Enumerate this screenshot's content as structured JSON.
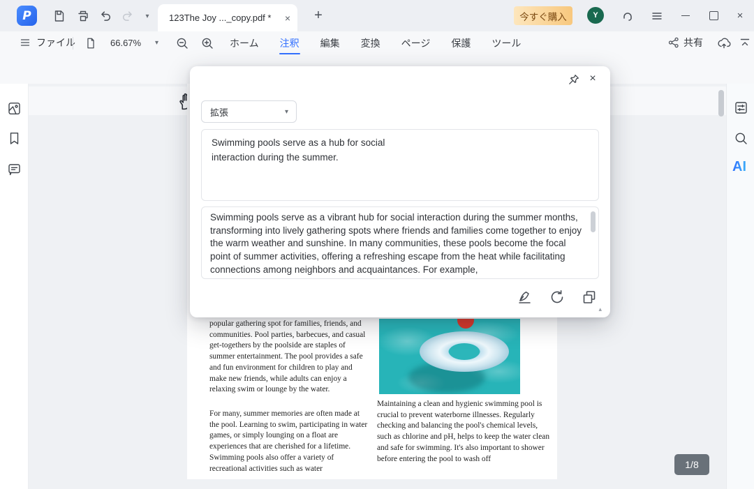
{
  "titlebar": {
    "tab_title": "123The Joy ..._copy.pdf *",
    "buy_label": "今すぐ購入",
    "avatar_initial": "Y"
  },
  "menubar": {
    "file_label": "ファイル",
    "zoom_level": "66.67%",
    "tabs": [
      {
        "label": "ホーム"
      },
      {
        "label": "注釈"
      },
      {
        "label": "編集"
      },
      {
        "label": "変換"
      },
      {
        "label": "ページ"
      },
      {
        "label": "保護"
      },
      {
        "label": "ツール"
      }
    ],
    "share_label": "共有"
  },
  "ai_panel": {
    "mode_selected": "拡張",
    "input_text": "Swimming pools serve as a hub for social\ninteraction during the summer.",
    "output_text": "Swimming pools serve as a vibrant hub for social interaction during the summer months, transforming into lively gathering spots where friends and families come together to enjoy the warm weather and sunshine. In many communities, these pools become the focal point of summer activities, offering a refreshing escape from the heat while facilitating connections among neighbors and acquaintances. For example,"
  },
  "document": {
    "left_paragraph_1": "popular gathering spot for families, friends, and communities. Pool parties, barbecues, and casual get-togethers by the poolside are staples of summer entertainment. The pool provides a safe and fun environment for children to play and make new friends, while adults can enjoy a relaxing swim or lounge by the water.",
    "left_paragraph_2": "For many, summer memories are often made at the pool. Learning to swim, participating in water games, or simply lounging on a float are experiences that are cherished for a lifetime. Swimming pools also offer a variety of recreational activities such as water",
    "right_paragraph_1": "Maintaining a clean and hygienic swimming pool is crucial to prevent waterborne illnesses. Regularly checking and balancing the pool's chemical levels, such as chlorine and pH, helps to keep the water clean and safe for swimming. It's also important to shower before entering the pool to wash off",
    "page_indicator": "1/8"
  },
  "icons": {
    "caret_down": "▾",
    "collapse_up": "▴",
    "close": "×",
    "plus": "+",
    "ai_label": "AI"
  },
  "colors": {
    "accent_blue": "#3370ff",
    "buy_gradient_end": "#f8c87e",
    "avatar_green": "#19694f",
    "pool_teal": "#27b4b8",
    "badge_gray": "#565e68"
  }
}
